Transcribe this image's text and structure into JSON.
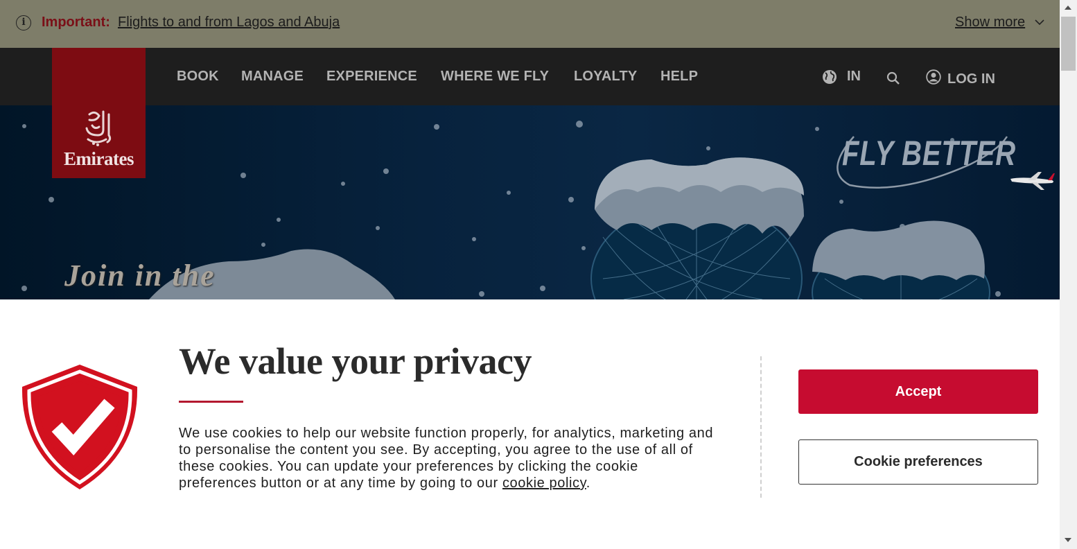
{
  "alert": {
    "label": "Important:",
    "link_text": "Flights to and from Lagos and Abuja",
    "show_more": "Show more"
  },
  "nav": {
    "items": [
      "BOOK",
      "MANAGE",
      "EXPERIENCE",
      "WHERE WE FLY",
      "LOYALTY",
      "HELP"
    ],
    "region": "IN",
    "login": "LOG IN"
  },
  "logo": {
    "text": "Emirates"
  },
  "hero": {
    "tagline": "FLY BETTER",
    "headline": "Join in the"
  },
  "cookie": {
    "title": "We value your privacy",
    "body": "We use cookies to help our website function properly, for analytics, marketing and to personalise the content you see. By accepting, you agree to the use of all of these cookies. You can update your preferences by clicking the cookie preferences button or at any time by going to our",
    "link_text": "cookie policy",
    "accept_label": "Accept",
    "preferences_label": "Cookie preferences"
  },
  "colors": {
    "brand_red": "#c60c30",
    "logo_red": "#7d0c12",
    "alert_bg": "#7e7d69",
    "nav_bg": "#1e1e1e"
  }
}
